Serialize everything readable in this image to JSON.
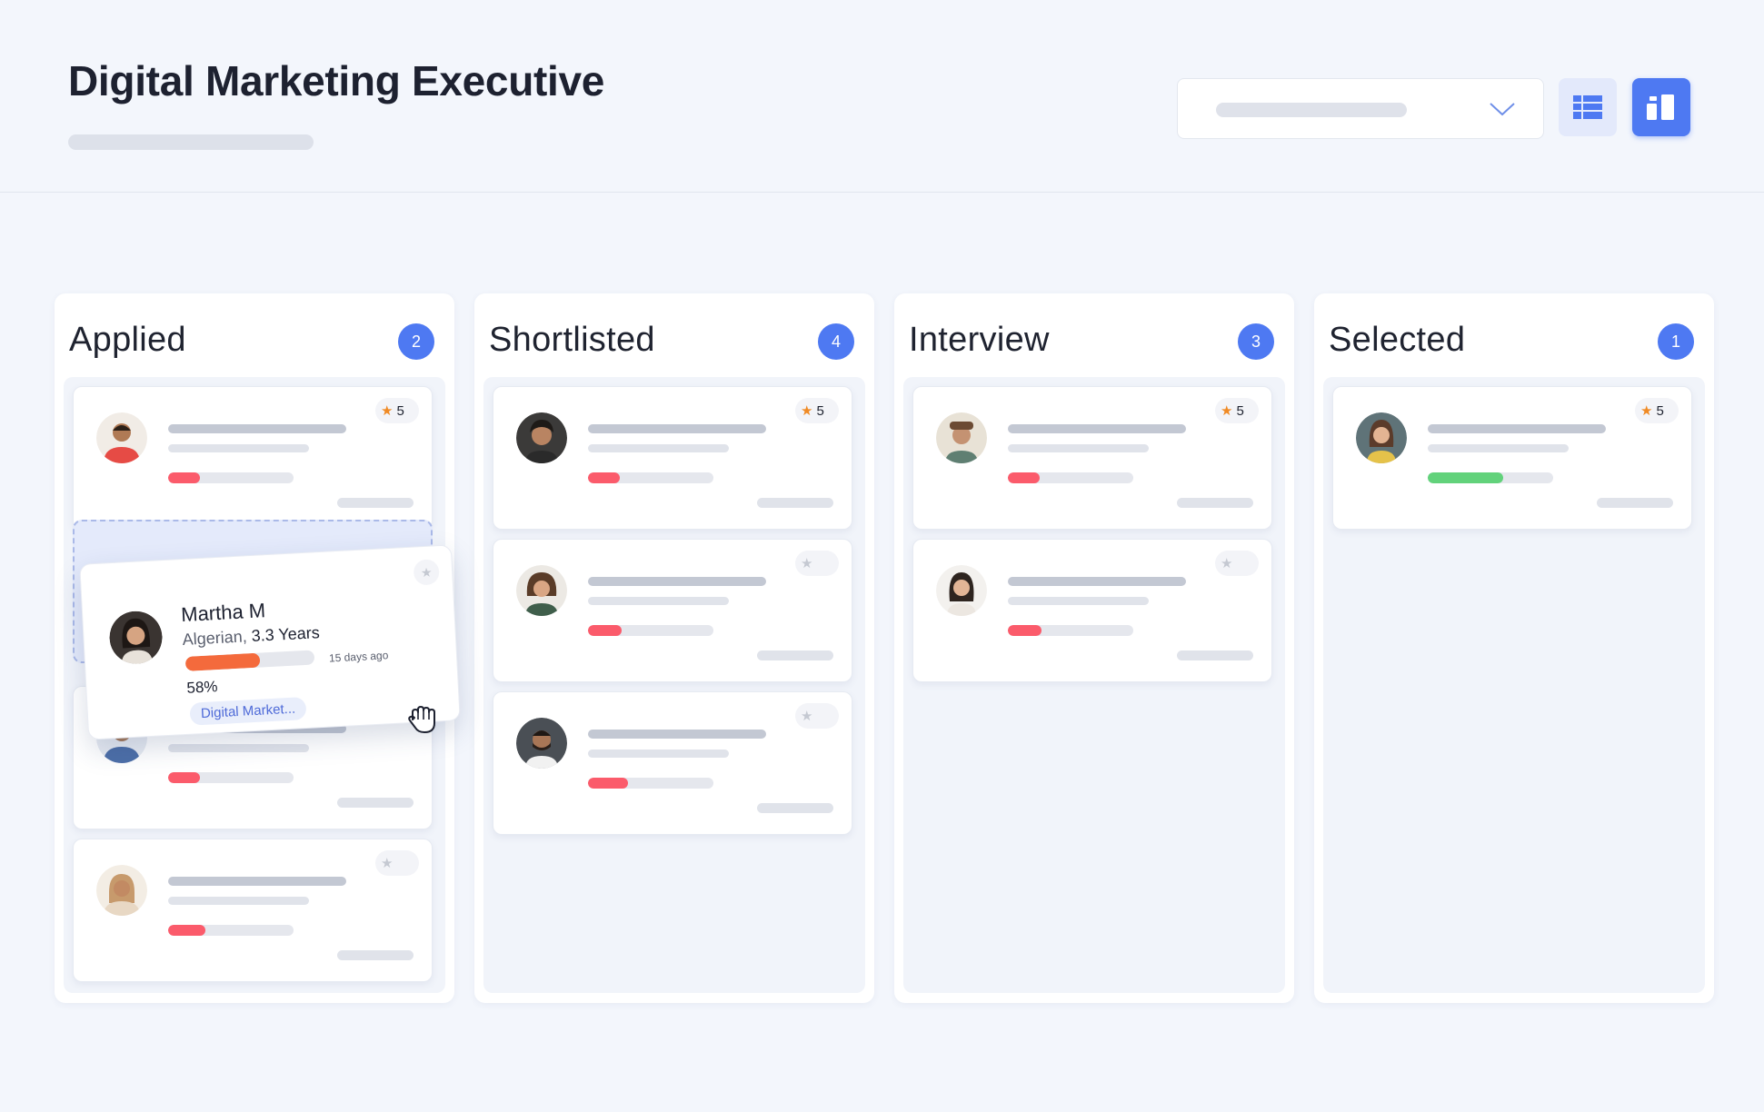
{
  "header": {
    "title": "Digital Marketing Executive"
  },
  "colors": {
    "accent": "#4e79f2",
    "progress_low": "#fb5b6b",
    "progress_high": "#62d27b",
    "progress_drag": "#f46a3c",
    "star": "#f08a24"
  },
  "columns": [
    {
      "title": "Applied",
      "count": "2"
    },
    {
      "title": "Shortlisted",
      "count": "4"
    },
    {
      "title": "Interview",
      "count": "3"
    },
    {
      "title": "Selected",
      "count": "1"
    }
  ],
  "cards": {
    "applied": [
      {
        "rating": "5",
        "progress": 0.25,
        "bar_color": "#fb5b6b",
        "icon": "avatar-man-red-shirt"
      },
      {
        "rating": "",
        "progress": 0.25,
        "bar_color": "#fb5b6b",
        "icon": "avatar-person-blue"
      },
      {
        "rating": "",
        "progress": 0.3,
        "bar_color": "#fb5b6b",
        "icon": "avatar-woman-headscarf"
      }
    ],
    "shortlisted": [
      {
        "rating": "5",
        "progress": 0.25,
        "bar_color": "#fb5b6b",
        "icon": "avatar-man-curly-hair"
      },
      {
        "rating": "",
        "progress": 0.27,
        "bar_color": "#fb5b6b",
        "icon": "avatar-woman-curly-hair"
      },
      {
        "rating": "",
        "progress": 0.32,
        "bar_color": "#fb5b6b",
        "icon": "avatar-man-beard"
      }
    ],
    "interview": [
      {
        "rating": "5",
        "progress": 0.25,
        "bar_color": "#fb5b6b",
        "icon": "avatar-man-hat"
      },
      {
        "rating": "",
        "progress": 0.27,
        "bar_color": "#fb5b6b",
        "icon": "avatar-woman-long-hair"
      }
    ],
    "selected": [
      {
        "rating": "5",
        "progress": 0.6,
        "bar_color": "#62d27b",
        "icon": "avatar-woman-yellow-top"
      }
    ]
  },
  "drag_card": {
    "name": "Martha M",
    "nationality": "Algerian,",
    "experience": "3.3 Years",
    "progress_label": "58%",
    "progress": 0.58,
    "time_ago": "15 days ago",
    "tag": "Digital Market..."
  }
}
